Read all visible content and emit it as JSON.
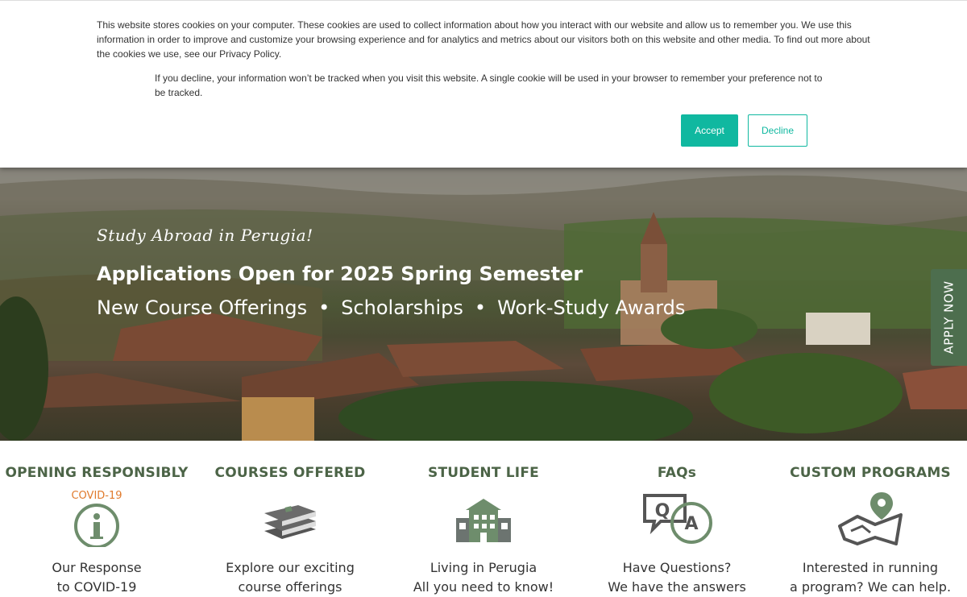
{
  "cookie": {
    "text1": "This website stores cookies on your computer. These cookies are used to collect information about how you interact with our website and allow us to remember you. We use this information in order to improve and customize your browsing experience and for analytics and metrics about our visitors both on this website and other media. To find out more about the cookies we use, see our Privacy Policy.",
    "text2": "If you decline, your information won’t be tracked when you visit this website. A single cookie will be used in your browser to remember your preference not to be tracked.",
    "accept_label": "Accept",
    "decline_label": "Decline"
  },
  "hero": {
    "tagline": "Study Abroad in Perugia!",
    "headline": "Applications Open for 2025 Spring Semester",
    "sub_items": [
      "New Course Offerings",
      "Scholarships",
      "Work-Study Awards"
    ],
    "separator": "•",
    "apply_label": "APPLY NOW"
  },
  "features": [
    {
      "title": "OPENING RESPONSIBLY",
      "badge": "COVID-19",
      "line1": "Our Response",
      "line2": "to COVID-19",
      "icon": "info-circle-icon"
    },
    {
      "title": "COURSES OFFERED",
      "line1": "Explore our exciting",
      "line2": "course offerings",
      "icon": "books-icon"
    },
    {
      "title": "STUDENT LIFE",
      "line1": "Living in Perugia",
      "line2": "All you need to know!",
      "icon": "building-icon"
    },
    {
      "title": "FAQs",
      "line1": "Have Questions?",
      "line2": "We have the answers",
      "icon": "qa-bubbles-icon"
    },
    {
      "title": "CUSTOM PROGRAMS",
      "line1": "Interested in running",
      "line2": "a program? We can help.",
      "icon": "map-pin-icon"
    }
  ],
  "colors": {
    "accent": "#10b8a0",
    "green": "#4c6447",
    "apply_bg": "#4d6e4e",
    "covid": "#e07a2c"
  }
}
